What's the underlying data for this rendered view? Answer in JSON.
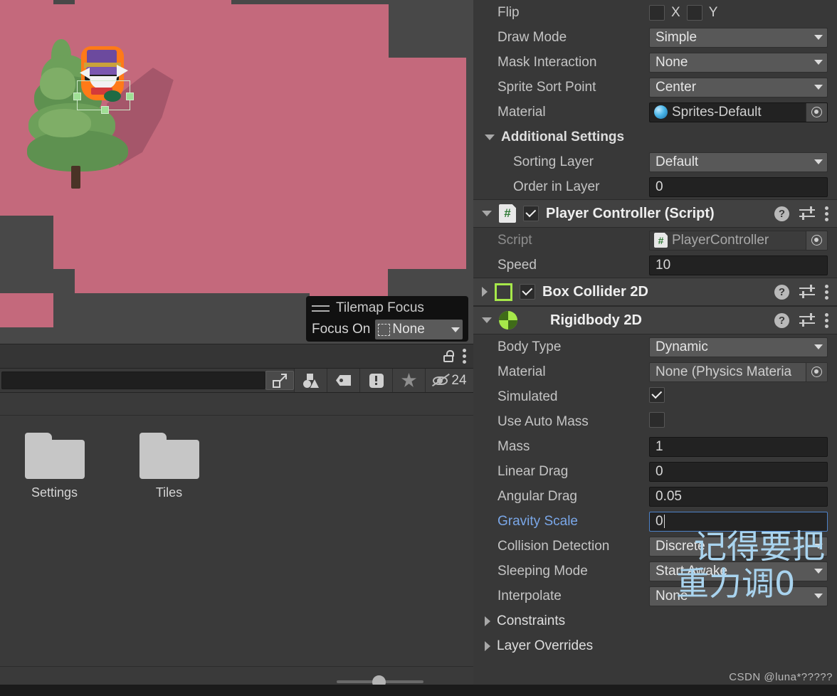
{
  "scene": {
    "tilemap_color": "#c4697c",
    "background_color": "#484848",
    "selection_outline_color": "#ff7a18",
    "collider_box_color": "#cfeccb",
    "tilemap_focus_popup": {
      "title": "Tilemap Focus",
      "focus_on_label": "Focus On",
      "focus_on_value": "None",
      "grip_icon": "drag-grip-icon",
      "dash_icon": "dashed-square-icon",
      "caret_icon": "chevron-down-icon"
    }
  },
  "project_panel": {
    "lock_icon": "unlocked-padlock-icon",
    "menu_icon": "kebab-menu-icon",
    "search_value": "",
    "search_placeholder": "",
    "toolbar_buttons": [
      {
        "name": "search-in-scene-icon",
        "glyph": "open-in-new-icon"
      },
      {
        "name": "filter-by-type-icon",
        "glyph": "shapes-icon"
      },
      {
        "name": "filter-by-label-icon",
        "glyph": "tag-icon"
      },
      {
        "name": "filter-warnings-icon",
        "glyph": "exclamation-icon"
      },
      {
        "name": "filter-favorites-icon",
        "glyph": "star-icon"
      }
    ],
    "hidden_toggle": {
      "icon": "eye-off-icon",
      "count": "24"
    },
    "assets": [
      {
        "name": "Settings",
        "icon": "folder-icon"
      },
      {
        "name": "Tiles",
        "icon": "folder-icon"
      }
    ],
    "zoom_slider_value": 41
  },
  "inspector": {
    "sprite_renderer_tail": {
      "flip": {
        "label": "Flip",
        "x_label": "X",
        "y_label": "Y",
        "x_checked": false,
        "y_checked": false
      },
      "draw_mode": {
        "label": "Draw Mode",
        "value": "Simple"
      },
      "mask_interaction": {
        "label": "Mask Interaction",
        "value": "None"
      },
      "sprite_sort_point": {
        "label": "Sprite Sort Point",
        "value": "Center"
      },
      "material": {
        "label": "Material",
        "value": "Sprites-Default",
        "icon": "material-sphere-icon"
      },
      "additional_settings": {
        "label": "Additional Settings",
        "expanded": true,
        "sorting_layer": {
          "label": "Sorting Layer",
          "value": "Default"
        },
        "order_in_layer": {
          "label": "Order in Layer",
          "value": "0"
        }
      }
    },
    "player_controller": {
      "title": "Player Controller (Script)",
      "expanded": true,
      "enabled": true,
      "icon": "csharp-script-icon",
      "script": {
        "label": "Script",
        "value": "PlayerController"
      },
      "speed": {
        "label": "Speed",
        "value": "10"
      }
    },
    "box_collider_2d": {
      "title": "Box Collider 2D",
      "expanded": false,
      "enabled": true,
      "icon": "box-collider-2d-icon"
    },
    "rigidbody_2d": {
      "title": "Rigidbody 2D",
      "expanded": true,
      "icon": "rigidbody-2d-icon",
      "body_type": {
        "label": "Body Type",
        "value": "Dynamic"
      },
      "material": {
        "label": "Material",
        "value": "None (Physics Materia"
      },
      "simulated": {
        "label": "Simulated",
        "checked": true
      },
      "use_auto_mass": {
        "label": "Use Auto Mass",
        "checked": false
      },
      "mass": {
        "label": "Mass",
        "value": "1"
      },
      "linear_drag": {
        "label": "Linear Drag",
        "value": "0"
      },
      "angular_drag": {
        "label": "Angular Drag",
        "value": "0.05"
      },
      "gravity_scale": {
        "label": "Gravity Scale",
        "value": "0",
        "focused": true,
        "highlighted": true
      },
      "collision_detection": {
        "label": "Collision Detection",
        "value": "Discrete"
      },
      "sleeping_mode": {
        "label": "Sleeping Mode",
        "value": "Start Awake"
      },
      "interpolate": {
        "label": "Interpolate",
        "value": "None"
      },
      "constraints": {
        "label": "Constraints",
        "expanded": false
      },
      "layer_overrides": {
        "label": "Layer Overrides",
        "expanded": false
      }
    },
    "component_header_icons": {
      "help": "help-icon",
      "preset": "preset-settings-icon",
      "menu": "kebab-menu-icon"
    }
  },
  "annotations": {
    "line1": "记得要把",
    "line2": "重力调0",
    "color": "#a9d4ef"
  },
  "watermark": "CSDN @luna*?????"
}
